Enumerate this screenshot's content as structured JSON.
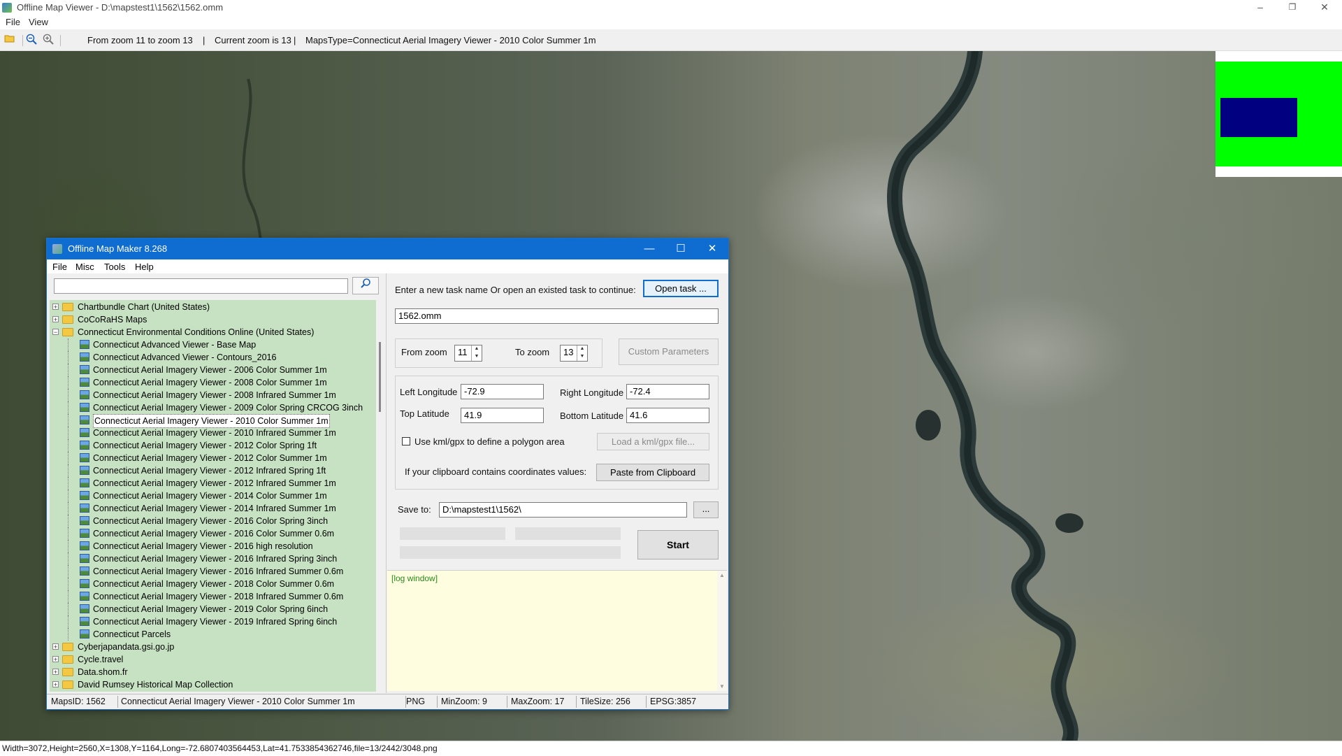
{
  "window": {
    "title": "Offline Map Viewer - D:\\mapstest1\\1562\\1562.omm",
    "minimize": "–",
    "maximize": "❐",
    "close": "✕"
  },
  "menu": {
    "file": "File",
    "view": "View"
  },
  "toolbar": {
    "zoom_range": "From zoom 11 to zoom 13",
    "separator": "|",
    "current_zoom": "Current zoom is 13",
    "separator2": "|",
    "maps_type": "MapsType=Connecticut Aerial Imagery Viewer - 2010 Color Summer 1m"
  },
  "status": {
    "text": "Width=3072,Height=2560,X=1308,Y=1164,Long=-72.6807403564453,Lat=41.7533854362746,file=13/2442/3048.png"
  },
  "colors": {
    "minimap_green": "#00ff00",
    "minimap_blue": "#000080",
    "dialog_title": "#0f6cd0",
    "tree_bg": "#c7e2c2",
    "log_bg": "#fffde0"
  },
  "dialog": {
    "title": "Offline Map Maker 8.268",
    "minimize": "—",
    "maximize": "☐",
    "close": "✕",
    "menu": {
      "file": "File",
      "misc": "Misc",
      "tools": "Tools",
      "help": "Help"
    },
    "search": {
      "value": "",
      "button_icon": "magnifier-icon"
    },
    "tree": [
      {
        "level": 0,
        "type": "folder",
        "expander": "+",
        "label": "Chartbundle Chart (United States)"
      },
      {
        "level": 0,
        "type": "folder",
        "expander": "+",
        "label": "CoCoRaHS Maps"
      },
      {
        "level": 0,
        "type": "folder",
        "expander": "−",
        "label": "Connecticut Environmental Conditions Online (United States)"
      },
      {
        "level": 1,
        "type": "map",
        "label": "Connecticut Advanced Viewer - Base Map"
      },
      {
        "level": 1,
        "type": "map",
        "label": "Connecticut Advanced Viewer - Contours_2016"
      },
      {
        "level": 1,
        "type": "map",
        "label": "Connecticut Aerial Imagery Viewer - 2006 Color Summer 1m"
      },
      {
        "level": 1,
        "type": "map",
        "label": "Connecticut Aerial Imagery Viewer - 2008 Color Summer 1m"
      },
      {
        "level": 1,
        "type": "map",
        "label": "Connecticut Aerial Imagery Viewer - 2008 Infrared Summer 1m"
      },
      {
        "level": 1,
        "type": "map",
        "label": "Connecticut Aerial Imagery Viewer - 2009 Color Spring CRCOG 3inch"
      },
      {
        "level": 1,
        "type": "map",
        "label": "Connecticut Aerial Imagery Viewer - 2010 Color Summer 1m",
        "selected": true
      },
      {
        "level": 1,
        "type": "map",
        "label": "Connecticut Aerial Imagery Viewer - 2010 Infrared Summer 1m"
      },
      {
        "level": 1,
        "type": "map",
        "label": "Connecticut Aerial Imagery Viewer - 2012 Color Spring 1ft"
      },
      {
        "level": 1,
        "type": "map",
        "label": "Connecticut Aerial Imagery Viewer - 2012 Color Summer 1m"
      },
      {
        "level": 1,
        "type": "map",
        "label": "Connecticut Aerial Imagery Viewer - 2012 Infrared Spring 1ft"
      },
      {
        "level": 1,
        "type": "map",
        "label": "Connecticut Aerial Imagery Viewer - 2012 Infrared Summer 1m"
      },
      {
        "level": 1,
        "type": "map",
        "label": "Connecticut Aerial Imagery Viewer - 2014 Color Summer 1m"
      },
      {
        "level": 1,
        "type": "map",
        "label": "Connecticut Aerial Imagery Viewer - 2014 Infrared Summer 1m"
      },
      {
        "level": 1,
        "type": "map",
        "label": "Connecticut Aerial Imagery Viewer - 2016 Color Spring 3inch"
      },
      {
        "level": 1,
        "type": "map",
        "label": "Connecticut Aerial Imagery Viewer - 2016 Color Summer 0.6m"
      },
      {
        "level": 1,
        "type": "map",
        "label": "Connecticut Aerial Imagery Viewer - 2016 high resolution"
      },
      {
        "level": 1,
        "type": "map",
        "label": "Connecticut Aerial Imagery Viewer - 2016 Infrared Spring 3inch"
      },
      {
        "level": 1,
        "type": "map",
        "label": "Connecticut Aerial Imagery Viewer - 2016 Infrared Summer 0.6m"
      },
      {
        "level": 1,
        "type": "map",
        "label": "Connecticut Aerial Imagery Viewer - 2018 Color Summer 0.6m"
      },
      {
        "level": 1,
        "type": "map",
        "label": "Connecticut Aerial Imagery Viewer - 2018 Infrared Summer 0.6m"
      },
      {
        "level": 1,
        "type": "map",
        "label": "Connecticut Aerial Imagery Viewer - 2019 Color Spring 6inch"
      },
      {
        "level": 1,
        "type": "map",
        "label": "Connecticut Aerial Imagery Viewer - 2019 Infrared Spring 6inch"
      },
      {
        "level": 1,
        "type": "map",
        "label": "Connecticut Parcels"
      },
      {
        "level": 0,
        "type": "folder",
        "expander": "+",
        "label": "Cyberjapandata.gsi.go.jp"
      },
      {
        "level": 0,
        "type": "folder",
        "expander": "+",
        "label": "Cycle.travel"
      },
      {
        "level": 0,
        "type": "folder",
        "expander": "+",
        "label": "Data.shom.fr"
      },
      {
        "level": 0,
        "type": "folder",
        "expander": "+",
        "label": "David Rumsey Historical Map Collection"
      }
    ],
    "task": {
      "prompt": "Enter a new task name Or open an existed task to continue:",
      "open_button": "Open task ...",
      "name_value": "1562.omm"
    },
    "zoom": {
      "from_label": "From zoom",
      "from_value": "11",
      "to_label": "To zoom",
      "to_value": "13",
      "custom_button": "Custom Parameters"
    },
    "coords": {
      "left_lon_label": "Left Longitude",
      "left_lon_value": "-72.9",
      "right_lon_label": "Right Longitude",
      "right_lon_value": "-72.4",
      "top_lat_label": "Top Latitude",
      "top_lat_value": "41.9",
      "bottom_lat_label": "Bottom Latitude",
      "bottom_lat_value": "41.6",
      "kml_checkbox_label": "Use kml/gpx to define a polygon area",
      "kml_checked": false,
      "load_kml_button": "Load a kml/gpx file...",
      "clipboard_label": "If your clipboard contains coordinates values:",
      "paste_button": "Paste from Clipboard"
    },
    "save": {
      "label": "Save to:",
      "value": "D:\\mapstest1\\1562\\",
      "browse_button": "...",
      "start_button": "Start"
    },
    "log": {
      "text": "[log window]"
    },
    "statusbar": {
      "maps_id": "MapsID: 1562",
      "map_name": "Connecticut Aerial Imagery Viewer - 2010 Color Summer 1m",
      "format": "PNG",
      "min_zoom": "MinZoom: 9",
      "max_zoom": "MaxZoom: 17",
      "tile_size": "TileSize: 256",
      "epsg": "EPSG:3857"
    }
  }
}
